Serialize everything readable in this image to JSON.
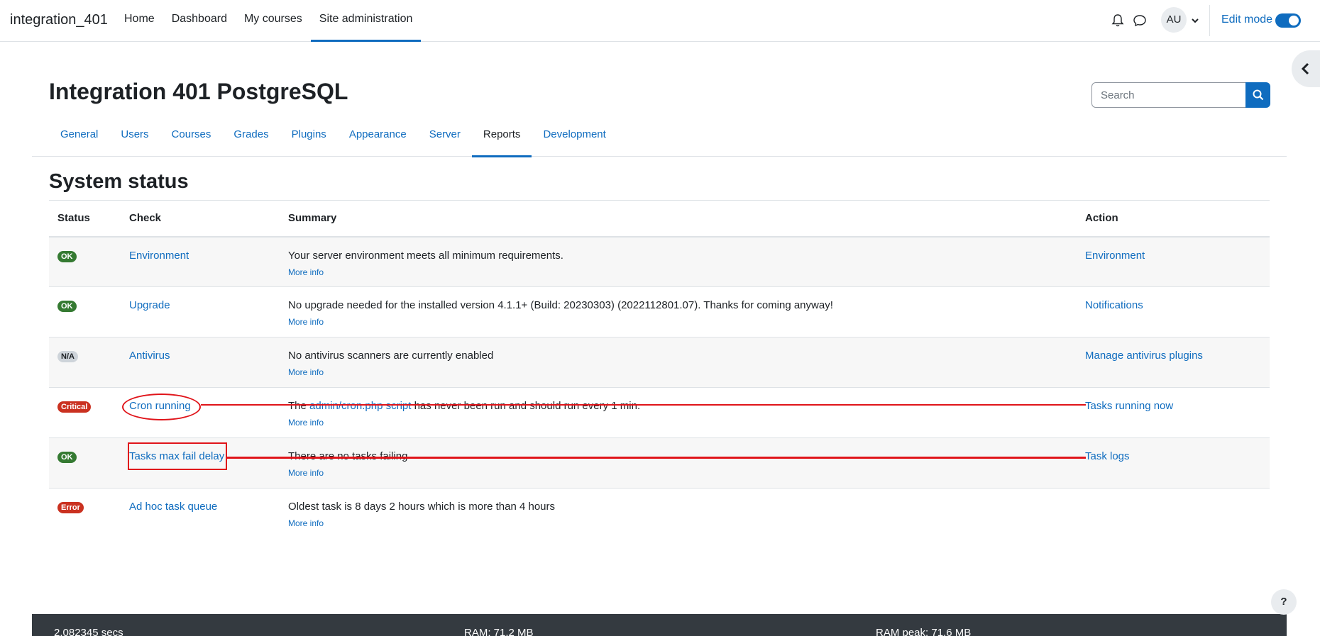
{
  "navbar": {
    "brand": "integration_401",
    "items": [
      {
        "label": "Home"
      },
      {
        "label": "Dashboard"
      },
      {
        "label": "My courses"
      },
      {
        "label": "Site administration"
      }
    ],
    "avatar_initials": "AU",
    "edit_mode_label": "Edit mode"
  },
  "page": {
    "title": "Integration 401 PostgreSQL",
    "search_placeholder": "Search"
  },
  "secondary_nav": {
    "tabs": [
      {
        "label": "General"
      },
      {
        "label": "Users"
      },
      {
        "label": "Courses"
      },
      {
        "label": "Grades"
      },
      {
        "label": "Plugins"
      },
      {
        "label": "Appearance"
      },
      {
        "label": "Server"
      },
      {
        "label": "Reports"
      },
      {
        "label": "Development"
      }
    ]
  },
  "section_title": "System status",
  "table": {
    "headers": {
      "status": "Status",
      "check": "Check",
      "summary": "Summary",
      "action": "Action"
    },
    "more_info": "More info",
    "rows": [
      {
        "status": "OK",
        "check": "Environment",
        "summary": "Your server environment meets all minimum requirements.",
        "action": "Environment"
      },
      {
        "status": "OK",
        "check": "Upgrade",
        "summary": "No upgrade needed for the installed version 4.1.1+ (Build: 20230303) (2022112801.07). Thanks for coming anyway!",
        "action": "Notifications"
      },
      {
        "status": "N/A",
        "check": "Antivirus",
        "summary": "No antivirus scanners are currently enabled",
        "action": "Manage antivirus plugins"
      },
      {
        "status": "Critical",
        "check": "Cron running",
        "summary_pre": "The ",
        "summary_link": "admin/cron.php script",
        "summary_post": " has never been run and should run every 1 min.",
        "action": "Tasks running now"
      },
      {
        "status": "OK",
        "check": "Tasks max fail delay",
        "summary": "There are no tasks failing",
        "action": "Task logs"
      },
      {
        "status": "Error",
        "check": "Ad hoc task queue",
        "summary": "Oldest task is 8 days 2 hours which is more than 4 hours",
        "action": ""
      }
    ]
  },
  "footer": {
    "time": "2.082345 secs",
    "ram": "RAM: 71.2 MB",
    "ram_peak": "RAM peak: 71.6 MB"
  },
  "help_label": "?",
  "colors": {
    "accent": "#0f6cbf",
    "ok": "#357a32",
    "critical": "#ca3120",
    "annotation": "#e0141a"
  }
}
